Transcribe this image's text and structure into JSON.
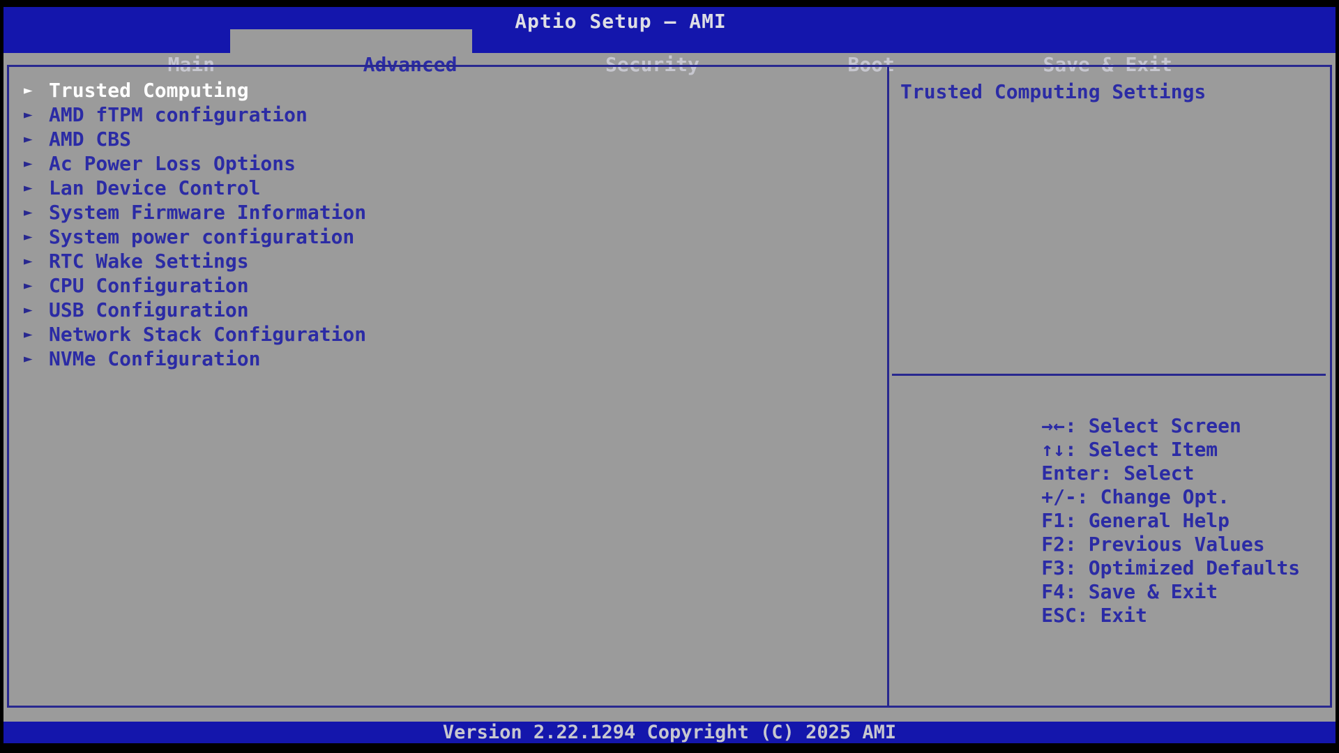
{
  "colors": {
    "header_footer_blue": "#1416AC",
    "body_gray": "#9B9B9B",
    "border_navy": "#28288F",
    "text_navy": "#2B2BA5",
    "selected_text_white": "#FFFFFF",
    "tab_text_light": "#C7C7CF"
  },
  "icons": {
    "submenu_arrow": "►"
  },
  "title_bar": {
    "title": "Aptio Setup – AMI"
  },
  "menu_bar": {
    "tabs": [
      {
        "label": "Main"
      },
      {
        "label": "Advanced",
        "selected": true
      },
      {
        "label": "Security"
      },
      {
        "label": "Boot"
      },
      {
        "label": "Save & Exit"
      }
    ]
  },
  "left_panel": {
    "items": [
      {
        "label": "Trusted Computing",
        "selected": true
      },
      {
        "label": "AMD fTPM configuration"
      },
      {
        "label": "AMD CBS"
      },
      {
        "label": "Ac Power Loss Options"
      },
      {
        "label": "Lan Device Control"
      },
      {
        "label": "System Firmware Information"
      },
      {
        "label": "System power configuration"
      },
      {
        "label": "RTC Wake Settings"
      },
      {
        "label": "CPU Configuration"
      },
      {
        "label": "USB Configuration"
      },
      {
        "label": "Network Stack Configuration"
      },
      {
        "label": "NVMe Configuration"
      }
    ]
  },
  "right_panel": {
    "help_text": "Trusted Computing Settings",
    "key_hints": [
      {
        "label": "→←: Select Screen"
      },
      {
        "label": "↑↓: Select Item"
      },
      {
        "label": "Enter: Select"
      },
      {
        "label": "+/-: Change Opt."
      },
      {
        "label": "F1: General Help"
      },
      {
        "label": "F2: Previous Values"
      },
      {
        "label": "F3: Optimized Defaults"
      },
      {
        "label": "F4: Save & Exit"
      },
      {
        "label": "ESC: Exit"
      }
    ]
  },
  "footer": {
    "version_text": "Version 2.22.1294 Copyright (C) 2025 AMI"
  }
}
